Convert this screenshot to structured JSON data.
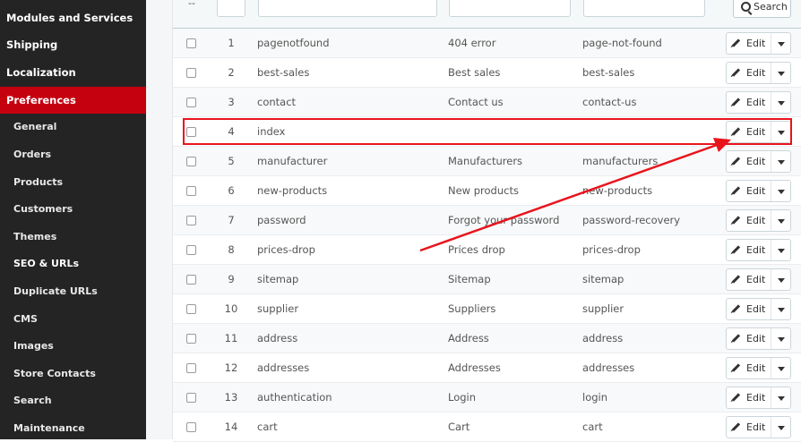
{
  "sidebar": {
    "items": [
      {
        "label": "Modules and Services",
        "level": "top"
      },
      {
        "label": "Shipping",
        "level": "top"
      },
      {
        "label": "Localization",
        "level": "top"
      },
      {
        "label": "Preferences",
        "level": "top",
        "active": true
      },
      {
        "label": "General",
        "level": "sub"
      },
      {
        "label": "Orders",
        "level": "sub"
      },
      {
        "label": "Products",
        "level": "sub"
      },
      {
        "label": "Customers",
        "level": "sub"
      },
      {
        "label": "Themes",
        "level": "sub"
      },
      {
        "label": "SEO & URLs",
        "level": "sub",
        "current": true
      },
      {
        "label": "Duplicate URLs",
        "level": "sub"
      },
      {
        "label": "CMS",
        "level": "sub"
      },
      {
        "label": "Images",
        "level": "sub"
      },
      {
        "label": "Store Contacts",
        "level": "sub"
      },
      {
        "label": "Search",
        "level": "sub"
      },
      {
        "label": "Maintenance",
        "level": "sub"
      }
    ]
  },
  "filter": {
    "bulk_label": "--",
    "search_label": "Search"
  },
  "table": {
    "rows": [
      {
        "id": "1",
        "page": "pagenotfound",
        "title": "404 error",
        "url": "page-not-found"
      },
      {
        "id": "2",
        "page": "best-sales",
        "title": "Best sales",
        "url": "best-sales"
      },
      {
        "id": "3",
        "page": "contact",
        "title": "Contact us",
        "url": "contact-us"
      },
      {
        "id": "4",
        "page": "index",
        "title": "",
        "url": ""
      },
      {
        "id": "5",
        "page": "manufacturer",
        "title": "Manufacturers",
        "url": "manufacturers"
      },
      {
        "id": "6",
        "page": "new-products",
        "title": "New products",
        "url": "new-products"
      },
      {
        "id": "7",
        "page": "password",
        "title": "Forgot your password",
        "url": "password-recovery"
      },
      {
        "id": "8",
        "page": "prices-drop",
        "title": "Prices drop",
        "url": "prices-drop"
      },
      {
        "id": "9",
        "page": "sitemap",
        "title": "Sitemap",
        "url": "sitemap"
      },
      {
        "id": "10",
        "page": "supplier",
        "title": "Suppliers",
        "url": "supplier"
      },
      {
        "id": "11",
        "page": "address",
        "title": "Address",
        "url": "address"
      },
      {
        "id": "12",
        "page": "addresses",
        "title": "Addresses",
        "url": "addresses"
      },
      {
        "id": "13",
        "page": "authentication",
        "title": "Login",
        "url": "login"
      },
      {
        "id": "14",
        "page": "cart",
        "title": "Cart",
        "url": "cart"
      }
    ],
    "edit_label": "Edit"
  },
  "colors": {
    "sidebar_bg": "#242424",
    "active_bg": "#c5000f",
    "annotation": "#e8141c"
  }
}
